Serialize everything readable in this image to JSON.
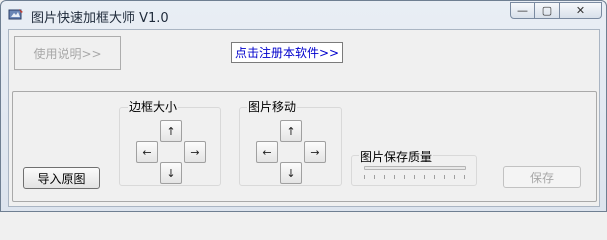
{
  "window": {
    "title": "图片快速加框大师 V1.0",
    "controls": {
      "minimize": "—",
      "maximize": "▢",
      "close": "✕"
    }
  },
  "toolbar": {
    "help_button": "使用说明>>",
    "register_link": "点击注册本软件>>"
  },
  "border_group": {
    "title": "边框大小",
    "up": "↑",
    "left": "←",
    "right": "→",
    "down": "↓"
  },
  "move_group": {
    "title": "图片移动",
    "up": "↑",
    "left": "←",
    "right": "→",
    "down": "↓"
  },
  "quality_group": {
    "title": "图片保存质量",
    "slider_value": 1.0
  },
  "actions": {
    "import_button": "导入原图",
    "save_button": "保存"
  },
  "colors": {
    "link": "#0000cc",
    "disabled_text": "#a8a8a8"
  },
  "icons": {
    "app": "app-icon"
  }
}
